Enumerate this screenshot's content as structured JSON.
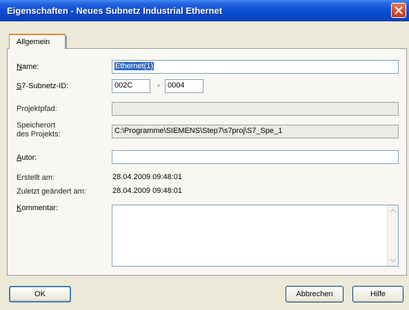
{
  "window": {
    "title": "Eigenschaften - Neues Subnetz Industrial Ethernet",
    "close_icon": "close-x-icon"
  },
  "tabs": [
    {
      "label": "Allgemein",
      "active": true
    }
  ],
  "form": {
    "name": {
      "label_mnemonic": "N",
      "label_rest": "ame:",
      "value": "Ethernet(1)"
    },
    "subnet_id": {
      "label_mnemonic": "S",
      "label_rest": "7-Subnetz-ID:",
      "part1": "002C",
      "separator": "-",
      "part2": "0004"
    },
    "project_path": {
      "label": "Projektpfad:",
      "value": ""
    },
    "storage_location": {
      "label_line1": "Speicherort",
      "label_line2": "des Projekts:",
      "value": "C:\\Programme\\SIEMENS\\Step7\\s7proj\\S7_Spe_1"
    },
    "author": {
      "label_mnemonic": "A",
      "label_rest": "utor:",
      "value": ""
    },
    "created": {
      "label": "Erstellt am:",
      "value": "28.04.2009 09:48:01"
    },
    "modified": {
      "label": "Zuletzt geändert am:",
      "value": "28.04.2009 09:48:01"
    },
    "comment": {
      "label_mnemonic": "K",
      "label_rest": "ommentar:",
      "value": ""
    }
  },
  "buttons": {
    "ok": "OK",
    "cancel": "Abbrechen",
    "help": "Hilfe"
  },
  "colors": {
    "titlebar": "#0a4fd4",
    "selection": "#316ac5",
    "close": "#d24a2c",
    "dialog_bg": "#ece9d8"
  }
}
